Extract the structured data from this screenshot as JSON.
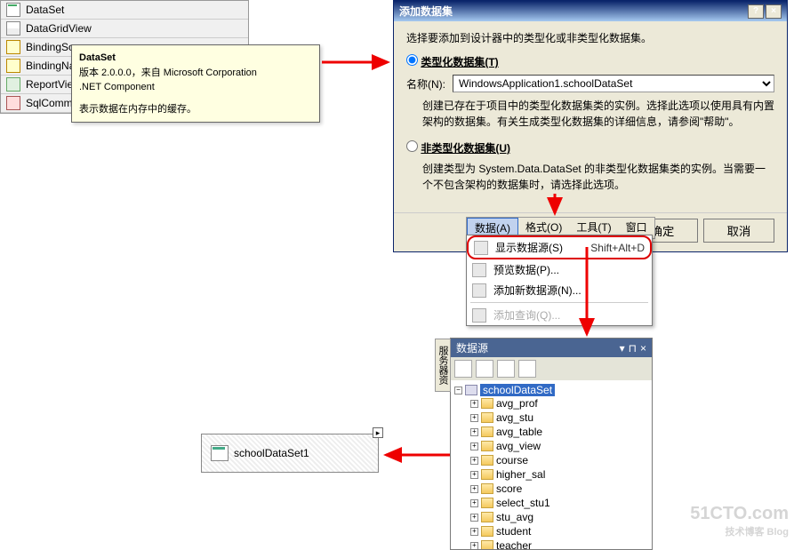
{
  "toolbox": {
    "items": [
      {
        "label": "DataSet"
      },
      {
        "label": "DataGridView"
      },
      {
        "label": "BindingSo"
      },
      {
        "label": "BindingNa"
      },
      {
        "label": "ReportVie"
      },
      {
        "label": "SqlComma"
      }
    ]
  },
  "tooltip": {
    "title": "DataSet",
    "line1": "版本 2.0.0.0，来自 Microsoft Corporation",
    "line2": ".NET Component",
    "line3": "表示数据在内存中的缓存。"
  },
  "dialog": {
    "title": "添加数据集",
    "description": "选择要添加到设计器中的类型化或非类型化数据集。",
    "radio_typed": "类型化数据集(T)",
    "name_label": "名称(N):",
    "name_value": "WindowsApplication1.schoolDataSet",
    "typed_help": "创建已存在于项目中的类型化数据集类的实例。选择此选项以使用具有内置架构的数据集。有关生成类型化数据集的详细信息，请参阅\"帮助\"。",
    "radio_untyped": "非类型化数据集(U)",
    "untyped_help": "创建类型为 System.Data.DataSet 的非类型化数据集类的实例。当需要一个不包含架构的数据集时，请选择此选项。",
    "ok": "确定",
    "cancel": "取消"
  },
  "menubar": {
    "items": [
      "数据(A)",
      "格式(O)",
      "工具(T)",
      "窗口"
    ]
  },
  "dropdown": {
    "items": [
      {
        "label": "显示数据源(S)",
        "shortcut": "Shift+Alt+D",
        "highlighted": true
      },
      {
        "label": "预览数据(P)..."
      },
      {
        "label": "添加新数据源(N)..."
      },
      {
        "sep": true
      },
      {
        "label": "添加查询(Q)...",
        "disabled": true
      }
    ]
  },
  "datasources": {
    "side_tab": "服务器资",
    "title": "数据源",
    "dropdown_icon": "▾",
    "pin_icon": "⊓",
    "close_icon": "×",
    "root": "schoolDataSet",
    "nodes": [
      "avg_prof",
      "avg_stu",
      "avg_table",
      "avg_view",
      "course",
      "higher_sal",
      "score",
      "select_stu1",
      "stu_avg",
      "student",
      "teacher"
    ]
  },
  "designer": {
    "badge": "▸",
    "component_name": "schoolDataSet1"
  },
  "watermark": {
    "main": "51CTO.com",
    "sub": "技术博客   Blog"
  }
}
